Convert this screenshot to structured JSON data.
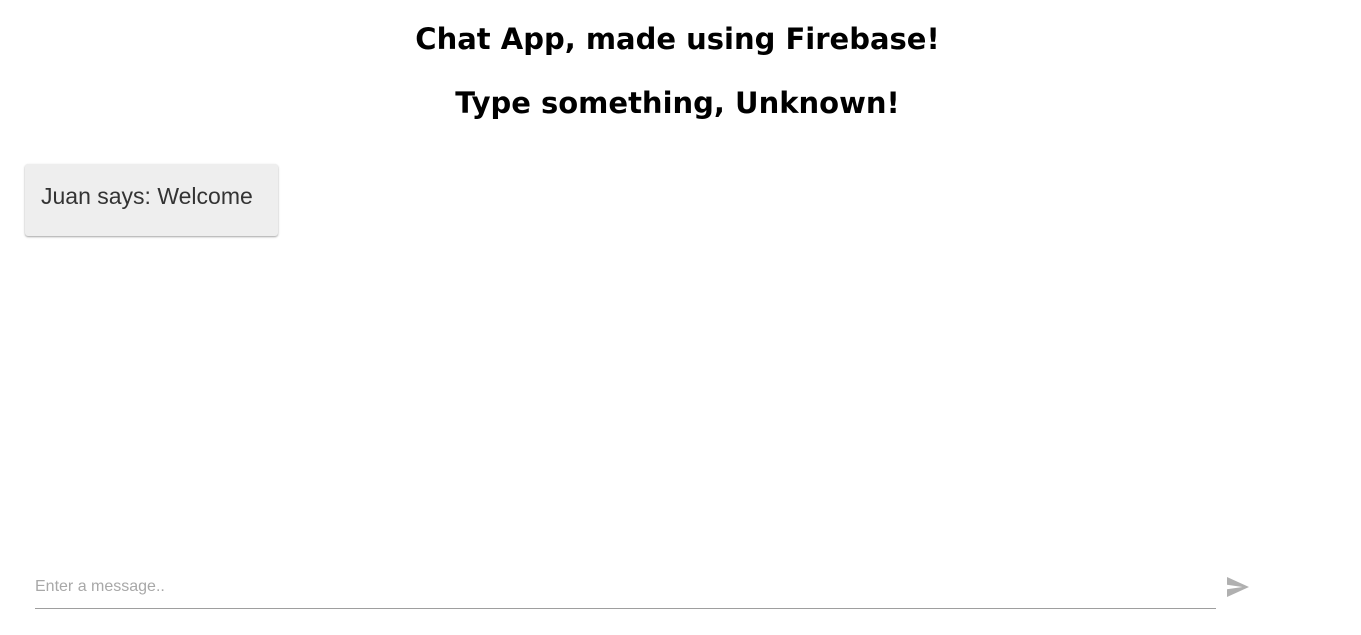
{
  "header": {
    "title": "Chat App, made using Firebase!",
    "subtitle": "Type something, Unknown!"
  },
  "messages": [
    {
      "text": "Juan says: Welcome"
    }
  ],
  "composer": {
    "placeholder": "Enter a message..",
    "value": "",
    "send_icon": "send-icon"
  },
  "colors": {
    "bubble_background": "#eeeeee",
    "input_underline": "#9e9e9e",
    "send_icon": "#b0b0b0",
    "placeholder": "#a8a8a8"
  }
}
